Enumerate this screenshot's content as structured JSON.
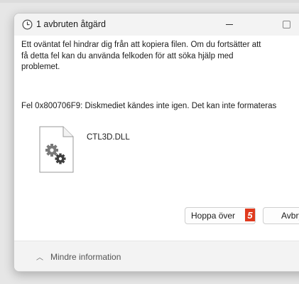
{
  "window": {
    "title": "1 avbruten åtgärd",
    "minimize_icon": "minimize-icon",
    "maximize_icon": "maximize-icon",
    "title_icon": "clock-icon"
  },
  "message": {
    "line1": "Ett oväntat fel hindrar dig från att kopiera filen. Om du fortsätter att",
    "line2": "få detta fel kan du använda felkoden för att söka hjälp med",
    "line3": "problemet.",
    "error": "Fel 0x800706F9: Diskmediet kändes inte igen. Det kan inte formateras"
  },
  "file": {
    "name": "CTL3D.DLL",
    "icon": "settings-file-icon"
  },
  "buttons": {
    "skip_label": "Hoppa över",
    "cancel_label": "Avbryt",
    "badge_number": "5"
  },
  "footer": {
    "toggle_label": "Mindre information",
    "toggle_icon": "chevron-up-icon"
  },
  "colors": {
    "badge": "#e03a1e",
    "titlebar": "#f3f3f3",
    "footer": "#f3f3f3"
  }
}
